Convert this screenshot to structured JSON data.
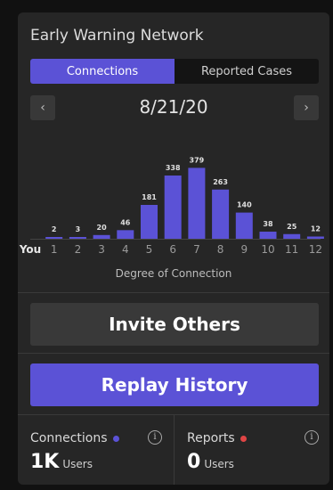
{
  "header": {
    "title": "Early Warning Network"
  },
  "tabs": [
    {
      "label": "Connections",
      "active": true
    },
    {
      "label": "Reported Cases",
      "active": false
    }
  ],
  "date_nav": {
    "date": "8/21/20",
    "prev_icon": "chevron-left-icon",
    "next_icon": "chevron-right-icon",
    "prev_glyph": "‹",
    "next_glyph": "›"
  },
  "chart_data": {
    "type": "bar",
    "categories": [
      "You",
      "1",
      "2",
      "3",
      "4",
      "5",
      "6",
      "7",
      "8",
      "9",
      "10",
      "11",
      "12"
    ],
    "values": [
      null,
      2,
      3,
      20,
      46,
      181,
      338,
      379,
      263,
      140,
      38,
      25,
      12
    ],
    "xlabel": "Degree of Connection",
    "ylim": [
      0,
      400
    ],
    "color": "#5b52d6"
  },
  "actions": {
    "invite_label": "Invite Others",
    "replay_label": "Replay History"
  },
  "stats": {
    "connections": {
      "label": "Connections",
      "value": "1K",
      "unit": "Users",
      "dot_color": "#5b52d6"
    },
    "reports": {
      "label": "Reports",
      "value": "0",
      "unit": "Users",
      "dot_color": "#e04545"
    },
    "info_glyph": "i"
  },
  "colors": {
    "accent": "#5b52d6",
    "background": "#262626"
  }
}
